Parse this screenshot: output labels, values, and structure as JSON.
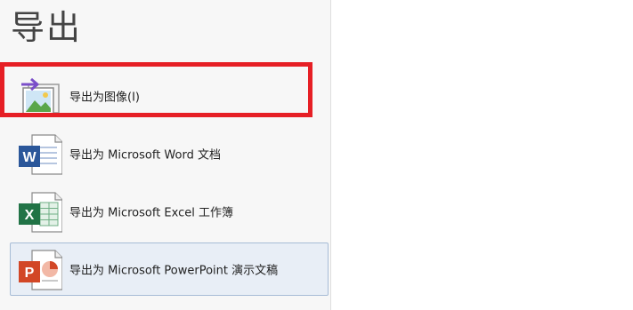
{
  "page": {
    "title": "导出"
  },
  "export_options": [
    {
      "label": "导出为图像(I)",
      "icon": "image-export-icon"
    },
    {
      "label": "导出为 Microsoft Word 文档",
      "icon": "word-icon"
    },
    {
      "label": "导出为 Microsoft Excel 工作簿",
      "icon": "excel-icon"
    },
    {
      "label": "导出为 Microsoft PowerPoint 演示文稿",
      "icon": "powerpoint-icon"
    }
  ],
  "colors": {
    "highlight_border": "#e61f25",
    "selected_bg": "#e8eef6",
    "word": "#2b579a",
    "excel": "#217346",
    "powerpoint": "#d24726",
    "arrow": "#7b4fc9"
  }
}
